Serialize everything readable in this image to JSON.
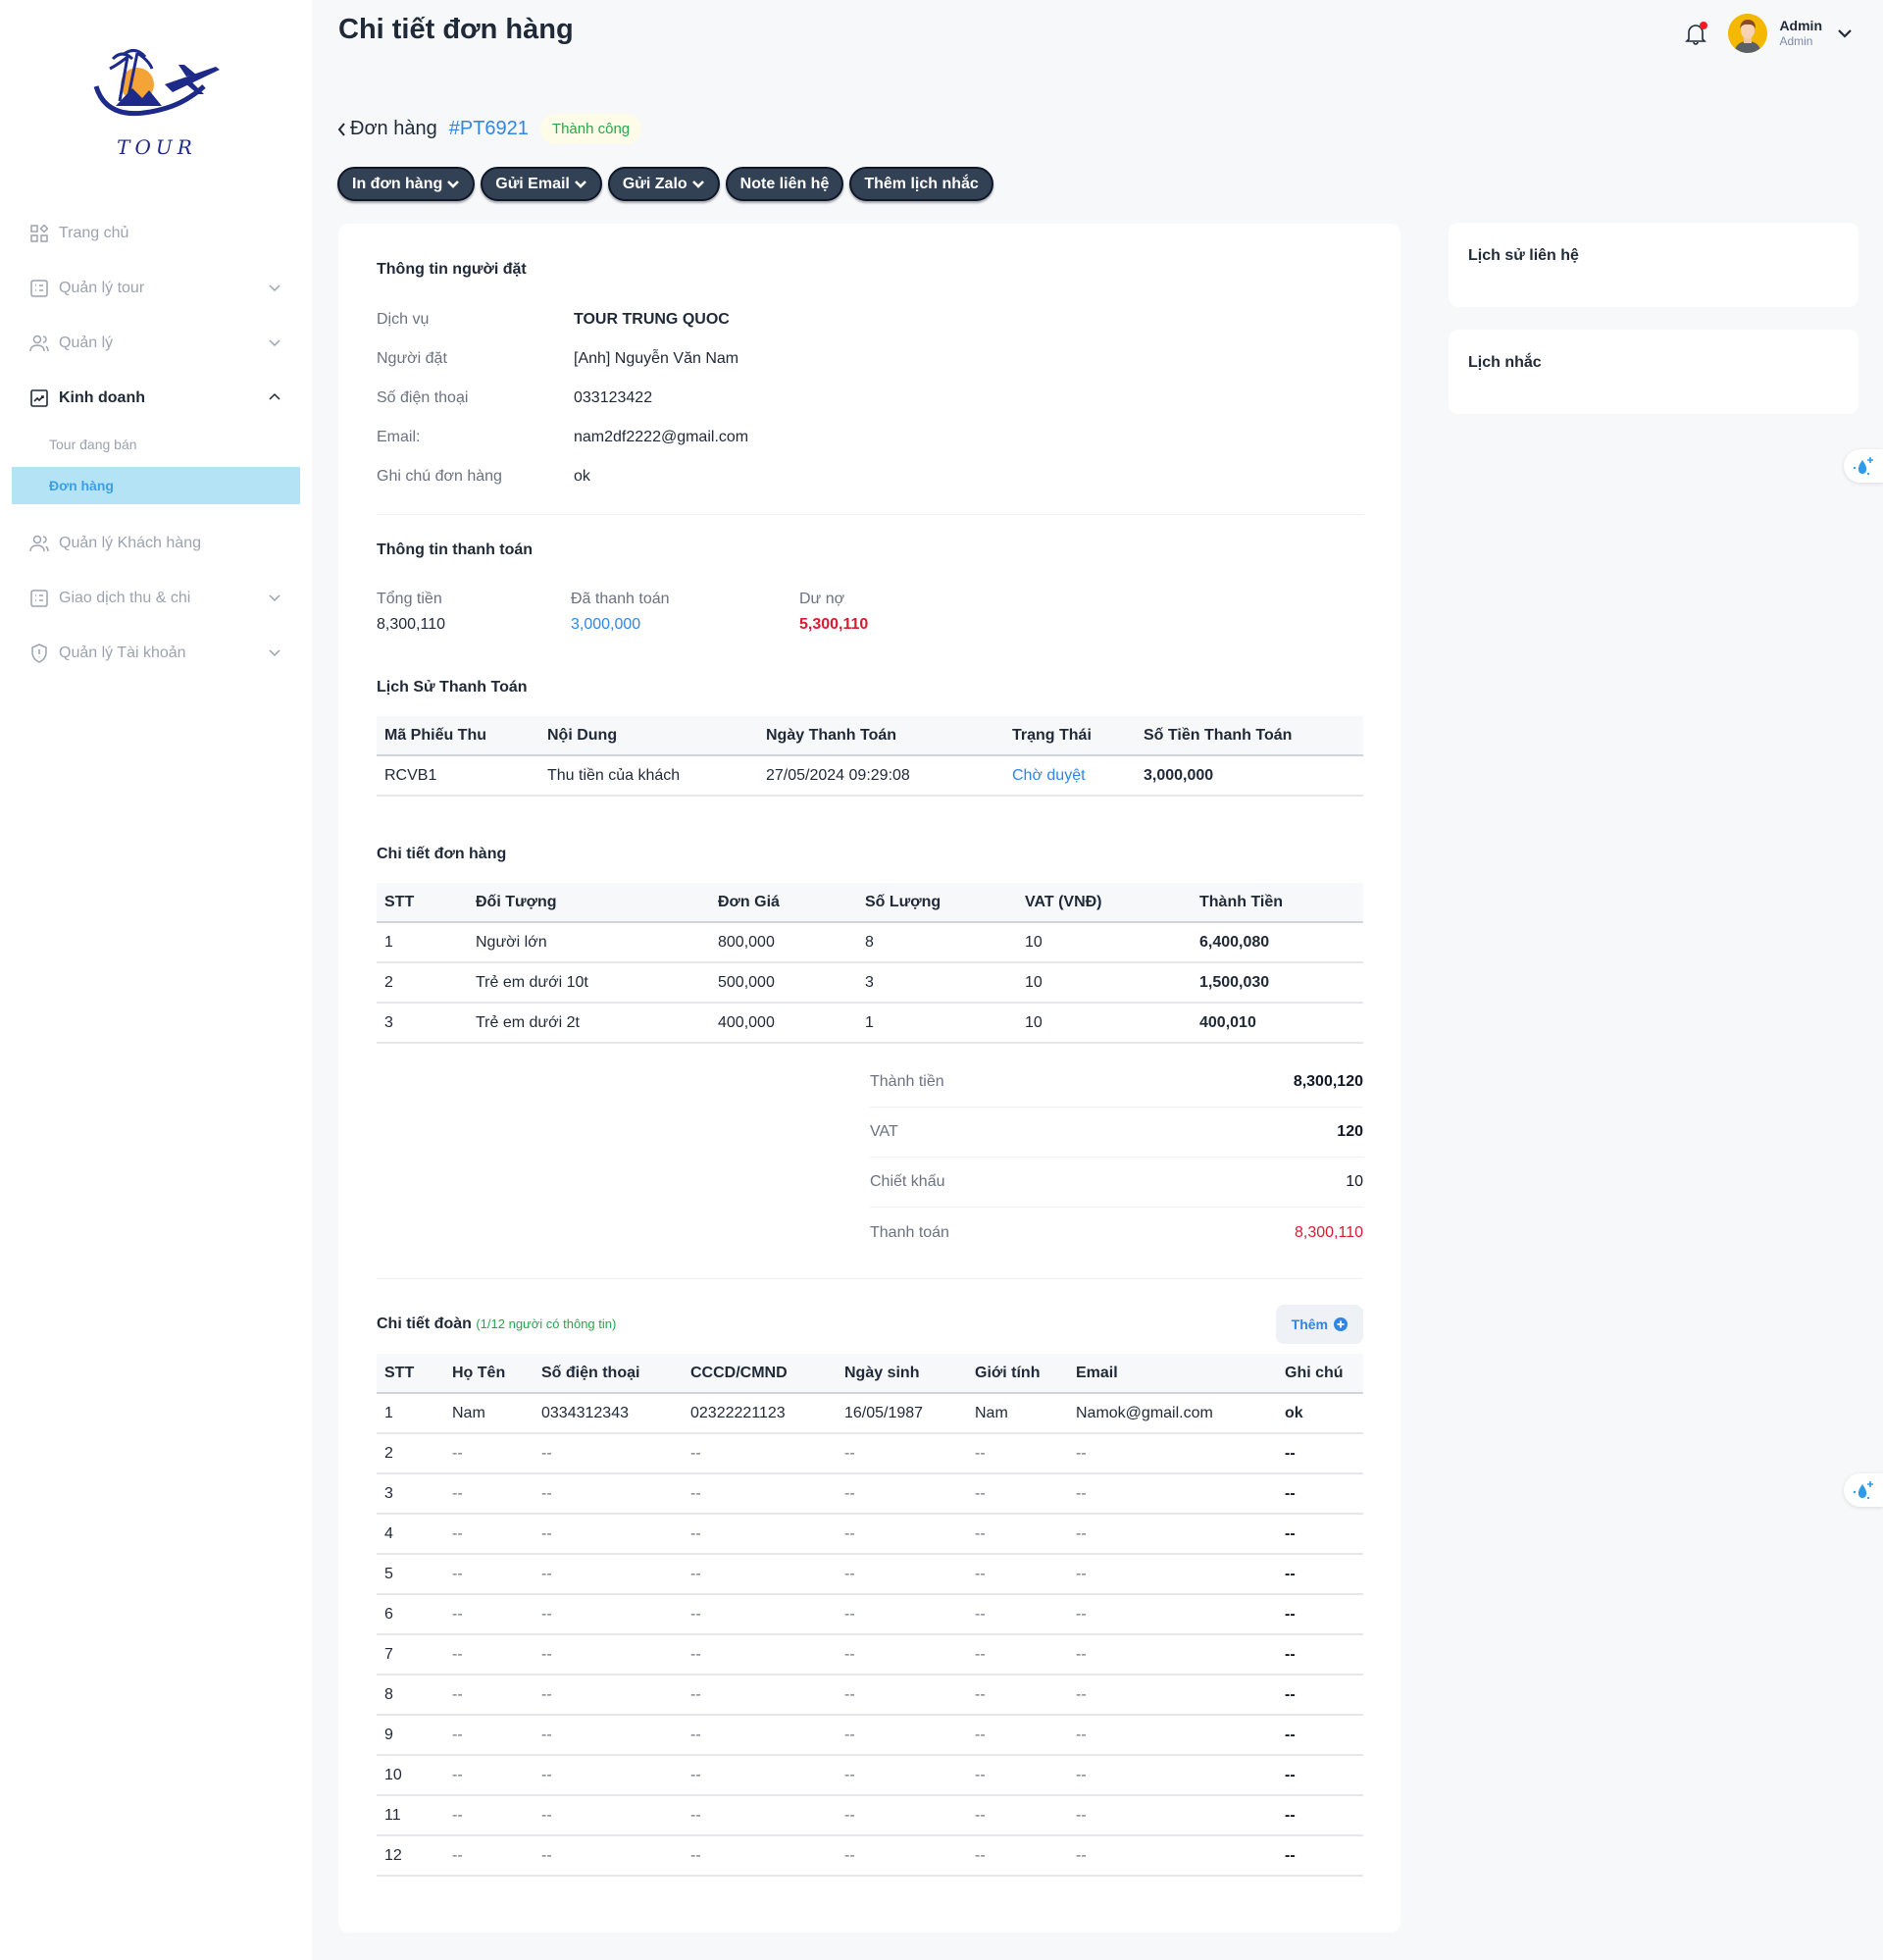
{
  "sidebar": {
    "logo_text": "TOUR",
    "items": [
      {
        "label": "Trang chủ",
        "icon": "dashboard-icon"
      },
      {
        "label": "Quản lý tour",
        "icon": "list-icon"
      },
      {
        "label": "Quản lý",
        "icon": "users-icon"
      },
      {
        "label": "Kinh doanh",
        "icon": "chart-icon"
      },
      {
        "label": "Quản lý Khách hàng",
        "icon": "users-icon"
      },
      {
        "label": "Giao dịch thu & chi",
        "icon": "list-icon"
      },
      {
        "label": "Quản lý Tài khoản",
        "icon": "shield-icon"
      }
    ],
    "sub_items": [
      {
        "label": "Tour đang bán"
      },
      {
        "label": "Đơn hàng"
      }
    ]
  },
  "header": {
    "title": "Chi tiết đơn hàng",
    "user_name": "Admin",
    "user_role": "Admin"
  },
  "breadcrumb": {
    "back_label": "Đơn hàng",
    "order_code": "#PT6921",
    "status": "Thành công"
  },
  "toolbar": {
    "print_label": "In đơn hàng",
    "email_label": "Gửi Email",
    "zalo_label": "Gửi Zalo",
    "note_label": "Note liên hệ",
    "reminder_label": "Thêm lịch nhắc"
  },
  "customer": {
    "title": "Thông tin người đặt",
    "rows": [
      {
        "label": "Dịch vụ",
        "value": "TOUR TRUNG QUOC"
      },
      {
        "label": "Người đặt",
        "value": "[Anh] Nguyễn Văn Nam"
      },
      {
        "label": "Số điện thoại",
        "value": "033123422"
      },
      {
        "label": "Email:",
        "value": "nam2df2222@gmail.com"
      },
      {
        "label": "Ghi chú đơn hàng",
        "value": "ok"
      }
    ]
  },
  "payment": {
    "title": "Thông tin thanh toán",
    "total_label": "Tổng tiền",
    "total": "8,300,110",
    "paid_label": "Đã thanh toán",
    "paid": "3,000,000",
    "debt_label": "Dư nợ",
    "debt": "5,300,110"
  },
  "payment_history": {
    "title": "Lịch Sử Thanh Toán",
    "columns": [
      "Mã Phiếu Thu",
      "Nội Dung",
      "Ngày Thanh Toán",
      "Trạng Thái",
      "Số Tiền Thanh Toán"
    ],
    "rows": [
      [
        "RCVB1",
        "Thu tiền của khách",
        "27/05/2024 09:29:08",
        "Chờ duyệt",
        "3,000,000"
      ]
    ]
  },
  "order_detail": {
    "title": "Chi tiết đơn hàng",
    "columns": [
      "STT",
      "Đối Tượng",
      "Đơn Giá",
      "Số Lượng",
      "VAT (VNĐ)",
      "Thành Tiền"
    ],
    "rows": [
      [
        "1",
        "Người lớn",
        "800,000",
        "8",
        "10",
        "6,400,080"
      ],
      [
        "2",
        "Trẻ em dưới 10t",
        "500,000",
        "3",
        "10",
        "1,500,030"
      ],
      [
        "3",
        "Trẻ em dưới 2t",
        "400,000",
        "1",
        "10",
        "400,010"
      ]
    ],
    "summary": [
      {
        "label": "Thành tiền",
        "value": "8,300,120"
      },
      {
        "label": "VAT",
        "value": "120"
      },
      {
        "label": "Chiết khấu",
        "value": "10"
      },
      {
        "label": "Thanh toán",
        "value": "8,300,110"
      }
    ]
  },
  "group": {
    "title": "Chi tiết đoàn",
    "note": "(1/12 người có thông tin)",
    "add_label": "Thêm",
    "columns": [
      "STT",
      "Họ Tên",
      "Số điện thoại",
      "CCCD/CMND",
      "Ngày sinh",
      "Giới tính",
      "Email",
      "Ghi chú"
    ],
    "rows": [
      [
        "1",
        "Nam",
        "0334312343",
        "02322221123",
        "16/05/1987",
        "Nam",
        "Namok@gmail.com",
        "ok"
      ],
      [
        "2",
        "--",
        "--",
        "--",
        "--",
        "--",
        "--",
        "--"
      ],
      [
        "3",
        "--",
        "--",
        "--",
        "--",
        "--",
        "--",
        "--"
      ],
      [
        "4",
        "--",
        "--",
        "--",
        "--",
        "--",
        "--",
        "--"
      ],
      [
        "5",
        "--",
        "--",
        "--",
        "--",
        "--",
        "--",
        "--"
      ],
      [
        "6",
        "--",
        "--",
        "--",
        "--",
        "--",
        "--",
        "--"
      ],
      [
        "7",
        "--",
        "--",
        "--",
        "--",
        "--",
        "--",
        "--"
      ],
      [
        "8",
        "--",
        "--",
        "--",
        "--",
        "--",
        "--",
        "--"
      ],
      [
        "9",
        "--",
        "--",
        "--",
        "--",
        "--",
        "--",
        "--"
      ],
      [
        "10",
        "--",
        "--",
        "--",
        "--",
        "--",
        "--",
        "--"
      ],
      [
        "11",
        "--",
        "--",
        "--",
        "--",
        "--",
        "--",
        "--"
      ],
      [
        "12",
        "--",
        "--",
        "--",
        "--",
        "--",
        "--",
        "--"
      ]
    ]
  },
  "side": {
    "contact_history_title": "Lịch sử liên hệ",
    "reminder_title": "Lịch nhắc"
  },
  "colors": {
    "accent_blue": "#2f86e5",
    "danger_red": "#d81b32",
    "success_green": "#22a94b",
    "button_dark": "#334155",
    "sidebar_selected": "#b3e3f5"
  }
}
